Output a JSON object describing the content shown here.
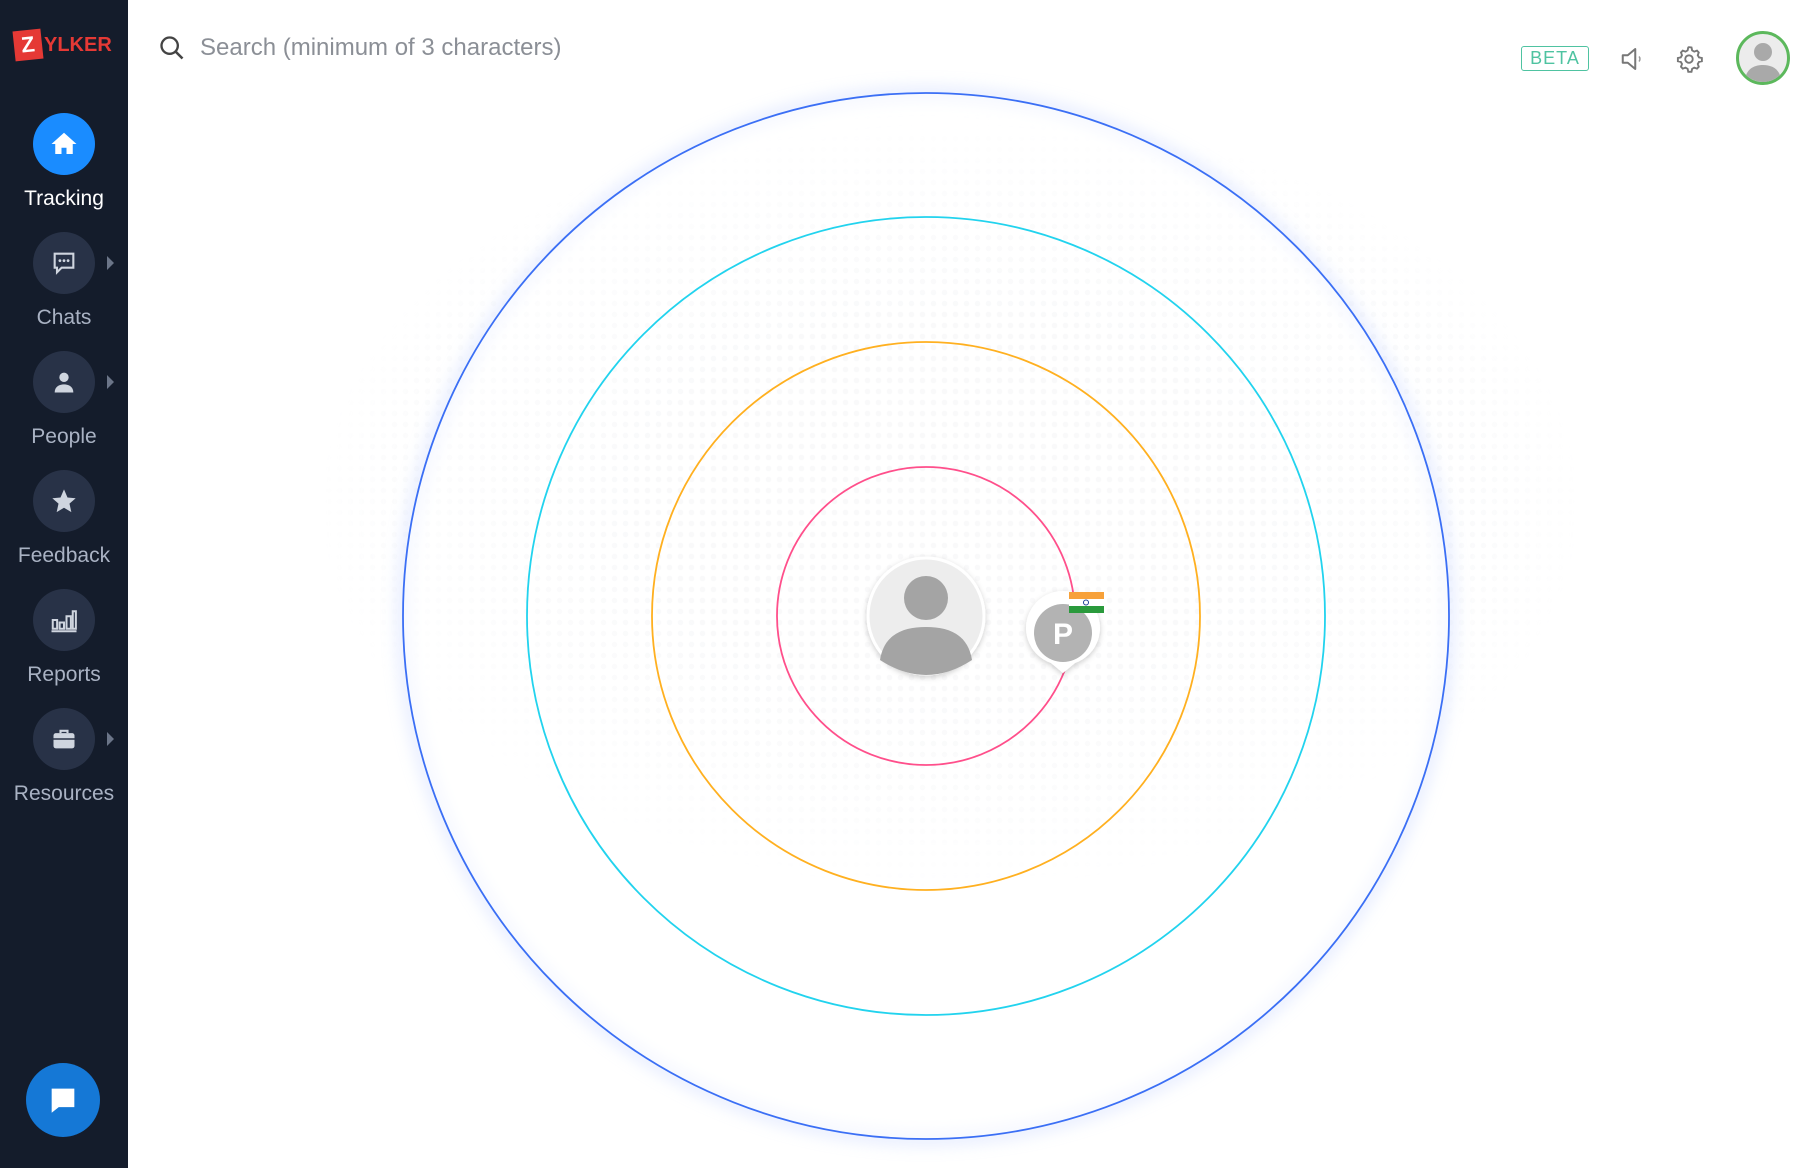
{
  "logo": {
    "text": "ZYLKER"
  },
  "sidebar": {
    "items": [
      {
        "label": "Tracking",
        "icon": "home-icon",
        "active": true,
        "has_submenu": false
      },
      {
        "label": "Chats",
        "icon": "chat-icon",
        "has_submenu": true
      },
      {
        "label": "People",
        "icon": "person-icon",
        "has_submenu": true
      },
      {
        "label": "Feedback",
        "icon": "star-icon",
        "has_submenu": false
      },
      {
        "label": "Reports",
        "icon": "bar-chart-icon",
        "has_submenu": false
      },
      {
        "label": "Resources",
        "icon": "briefcase-icon",
        "has_submenu": true
      }
    ]
  },
  "header": {
    "search_placeholder": "Search (minimum of 3 characters)",
    "beta_badge": "BETA"
  },
  "radar": {
    "ring_colors": [
      "#ff4f8b",
      "#ffb020",
      "#22d3ee",
      "#3b6ff5"
    ],
    "visitor": {
      "initial": "P",
      "country_flag": "India"
    }
  },
  "colors": {
    "sidebar_bg": "#141c2b",
    "accent": "#1a8cff",
    "beta": "#4fc3a1"
  }
}
